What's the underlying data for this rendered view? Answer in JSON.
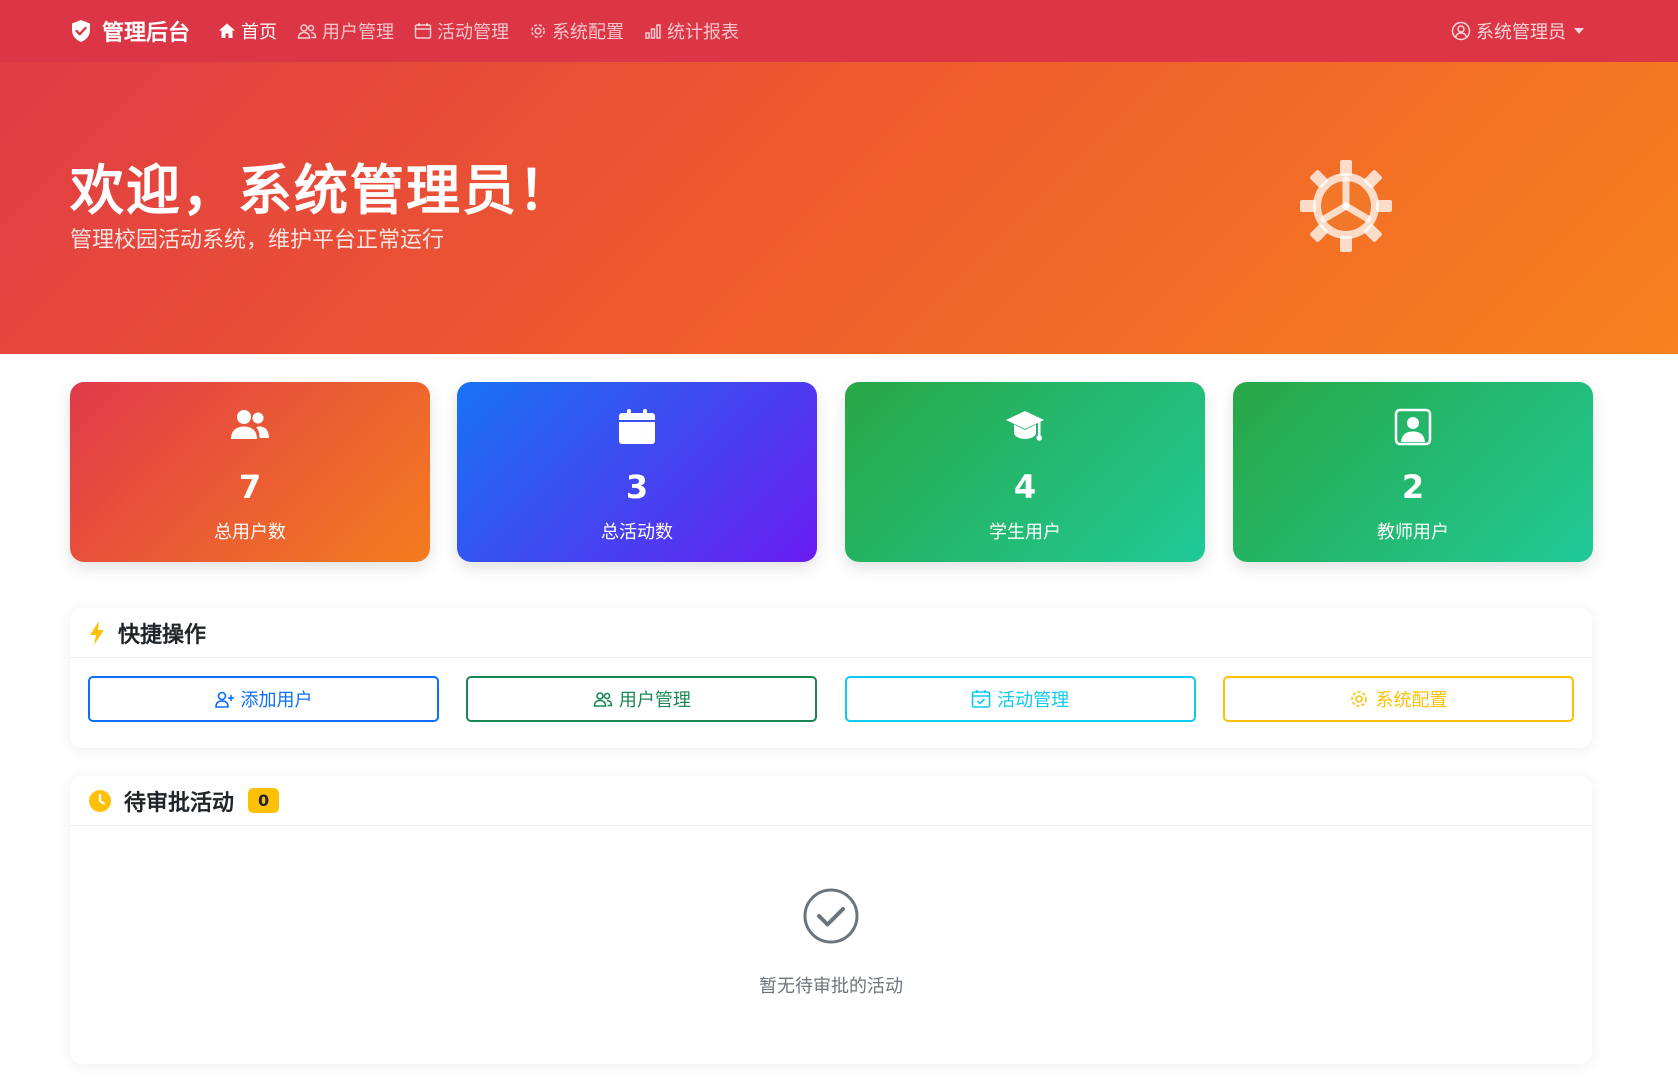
{
  "navbar": {
    "brand": "管理后台",
    "items": [
      {
        "label": "首页",
        "icon": "home-icon",
        "active": true
      },
      {
        "label": "用户管理",
        "icon": "people-icon"
      },
      {
        "label": "活动管理",
        "icon": "calendar-icon"
      },
      {
        "label": "系统配置",
        "icon": "gear-icon"
      },
      {
        "label": "统计报表",
        "icon": "bar-chart-icon"
      }
    ],
    "user": "系统管理员"
  },
  "hero": {
    "title": "欢迎，系统管理员！",
    "subtitle": "管理校园活动系统，维护平台正常运行"
  },
  "stats": [
    {
      "value": "7",
      "label": "总用户数",
      "icon": "people-fill-icon"
    },
    {
      "value": "3",
      "label": "总活动数",
      "icon": "calendar-fill-icon"
    },
    {
      "value": "4",
      "label": "学生用户",
      "icon": "mortarboard-icon"
    },
    {
      "value": "2",
      "label": "教师用户",
      "icon": "person-badge-icon"
    }
  ],
  "quick_actions": {
    "title": "快捷操作",
    "buttons": [
      {
        "label": "添加用户",
        "color": "#0d6efd"
      },
      {
        "label": "用户管理",
        "color": "#198754"
      },
      {
        "label": "活动管理",
        "color": "#0dcaf0"
      },
      {
        "label": "系统配置",
        "color": "#ffc107"
      }
    ]
  },
  "pending": {
    "title": "待审批活动",
    "count": "0",
    "empty_text": "暂无待审批的活动"
  },
  "colors": {
    "primary_red": "#dc3545",
    "accent_orange": "#f7821e"
  }
}
